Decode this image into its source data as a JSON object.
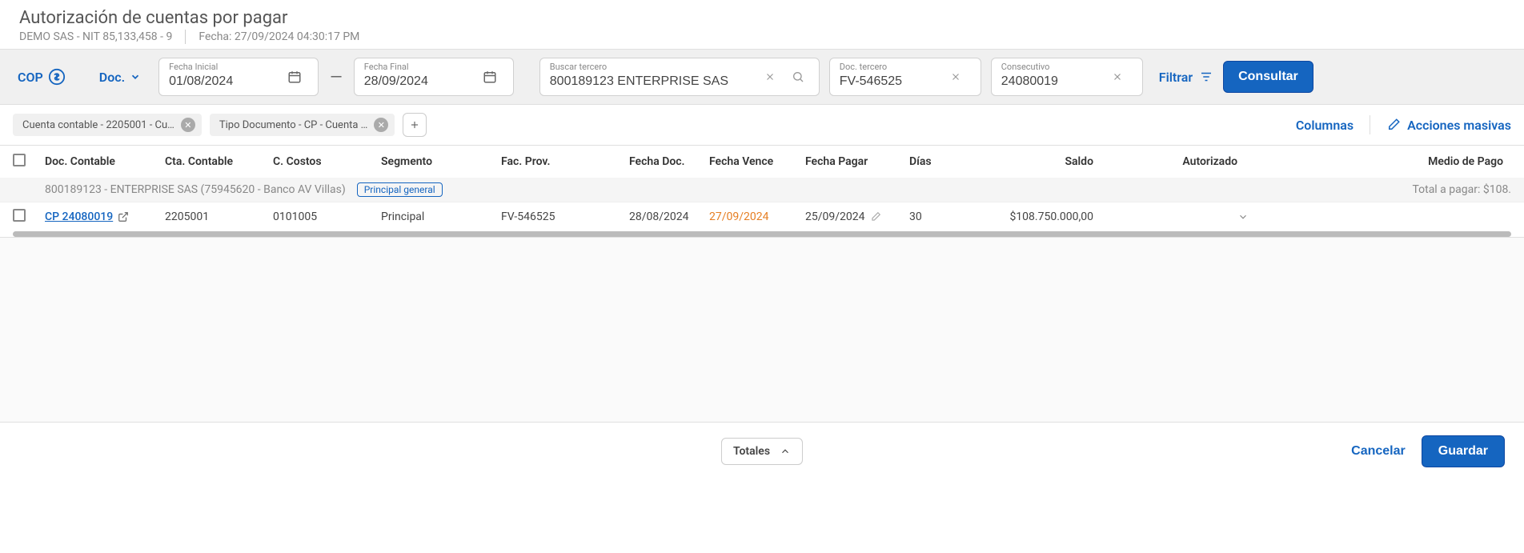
{
  "header": {
    "title": "Autorización de cuentas por pagar",
    "company": "DEMO SAS - NIT 85,133,458 - 9",
    "timestamp": "Fecha: 27/09/2024 04:30:17 PM"
  },
  "filters": {
    "currency": "COP",
    "doc_label": "Doc.",
    "fecha_inicial_label": "Fecha Inicial",
    "fecha_inicial": "01/08/2024",
    "fecha_final_label": "Fecha Final",
    "fecha_final": "28/09/2024",
    "tercero_label": "Buscar tercero",
    "tercero": "800189123 ENTERPRISE SAS",
    "doc_tercero_label": "Doc. tercero",
    "doc_tercero": "FV-546525",
    "consecutivo_label": "Consecutivo",
    "consecutivo": "24080019",
    "filtrar_label": "Filtrar",
    "consultar_label": "Consultar"
  },
  "chips": [
    "Cuenta contable - 2205001 - Cu…",
    "Tipo Documento - CP - Cuenta …"
  ],
  "actions": {
    "columnas": "Columnas",
    "masivas": "Acciones masivas"
  },
  "columns": {
    "doc_contable": "Doc. Contable",
    "cta_contable": "Cta. Contable",
    "c_costos": "C. Costos",
    "segmento": "Segmento",
    "fac_prov": "Fac. Prov.",
    "fecha_doc": "Fecha Doc.",
    "fecha_vence": "Fecha Vence",
    "fecha_pagar": "Fecha Pagar",
    "dias": "Días",
    "saldo": "Saldo",
    "autorizado": "Autorizado",
    "medio_pago": "Medio de Pago"
  },
  "group": {
    "name": "800189123 - ENTERPRISE SAS (75945620 - Banco AV Villas)",
    "badge": "Principal general",
    "total_label": "Total a pagar: $108."
  },
  "row": {
    "doc": "CP 24080019",
    "cta": "2205001",
    "costos": "0101005",
    "segmento": "Principal",
    "fac": "FV-546525",
    "fecha_doc": "28/08/2024",
    "fecha_vence": "27/09/2024",
    "fecha_pagar": "25/09/2024",
    "dias": "30",
    "saldo": "$108.750.000,00"
  },
  "footer": {
    "totales": "Totales",
    "cancelar": "Cancelar",
    "guardar": "Guardar"
  },
  "chart_data": {
    "type": "table",
    "title": "Autorización de cuentas por pagar",
    "columns": [
      "Doc. Contable",
      "Cta. Contable",
      "C. Costos",
      "Segmento",
      "Fac. Prov.",
      "Fecha Doc.",
      "Fecha Vence",
      "Fecha Pagar",
      "Días",
      "Saldo",
      "Autorizado",
      "Medio de Pago"
    ],
    "rows": [
      [
        "CP 24080019",
        "2205001",
        "0101005",
        "Principal",
        "FV-546525",
        "28/08/2024",
        "27/09/2024",
        "25/09/2024",
        "30",
        "$108.750.000,00",
        "",
        ""
      ]
    ]
  }
}
